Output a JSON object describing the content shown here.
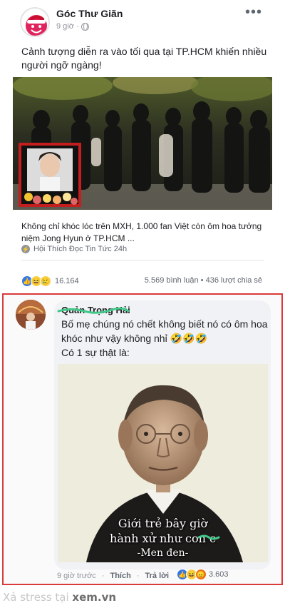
{
  "post": {
    "page_name": "Góc Thư Giãn",
    "time": "9 giờ",
    "meta_sep": "·",
    "text": "Cảnh tượng diễn ra vào tối qua tại TP.HCM khiến nhiều người ngỡ ngàng!",
    "more_icon": "more-icon",
    "privacy_icon": "globe-icon"
  },
  "link": {
    "title": "Không chỉ khóc lóc trên MXH, 1.000 fan Việt còn ôm hoa tưởng niệm Jong Hyun ở TP.HCM ...",
    "source": "Hội Thích Đọc Tin Tức 24h"
  },
  "stats": {
    "reaction_count": "16.164",
    "engagement": "5.569 bình luận • 436 lượt chia sẻ",
    "reaction_icons": [
      "like-icon",
      "haha-icon",
      "sad-icon"
    ]
  },
  "comment": {
    "name": "Quản Trọng Hải",
    "text_line1": "Bố mẹ chúng nó chết không biết nó có ôm hoa khóc như vậy không nhỉ 🤣🤣🤣",
    "text_line2": "Có 1 sự thật là:",
    "meme": {
      "line1": "Giới trẻ bây giờ",
      "line2": "hành xử như con c",
      "line3": "-Men đen-"
    },
    "time": "9 giờ trước",
    "like": "Thích",
    "reply": "Trả lời",
    "reaction_count": "3.603",
    "reaction_icons": [
      "like-icon",
      "haha-icon",
      "angry-icon"
    ]
  },
  "watermark": {
    "text": "Xả stress tại ",
    "site": "xem.vn"
  },
  "colors": {
    "highlight_border": "#d93b3b",
    "like": "#3578e5",
    "muted": "#606770"
  }
}
